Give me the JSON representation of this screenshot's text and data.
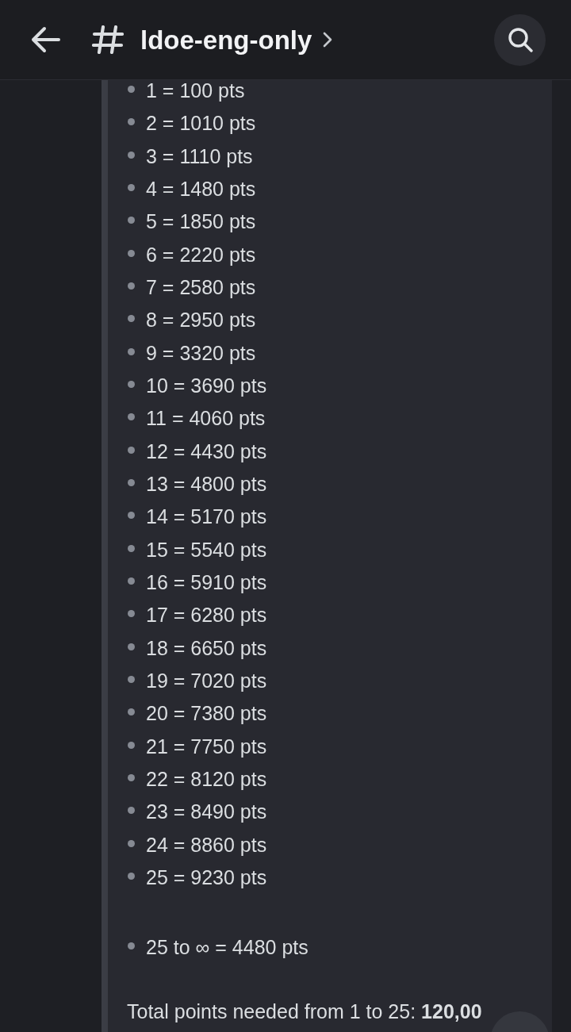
{
  "header": {
    "channel_name": "ldoe-eng-only"
  },
  "message": {
    "levels": [
      "1 = 100 pts",
      "2 = 1010 pts",
      "3 = 1110 pts",
      "4 = 1480 pts",
      "5 = 1850 pts",
      "6 = 2220 pts",
      "7 = 2580 pts",
      "8 = 2950 pts",
      "9 = 3320 pts",
      "10 = 3690 pts",
      "11 = 4060 pts",
      "12 = 4430 pts",
      "13 = 4800 pts",
      "14 = 5170 pts",
      "15 = 5540 pts",
      "16 = 5910 pts",
      "17 = 6280 pts",
      "18 = 6650 pts",
      "19 = 7020 pts",
      "20 = 7380 pts",
      "21 = 7750 pts",
      "22 = 8120 pts",
      "23 = 8490 pts",
      "24 = 8860 pts",
      "25 = 9230 pts"
    ],
    "after_levels": [
      "25 to ∞ = 4480 pts"
    ],
    "total": "Total points needed from 1 to 25: **120,00**"
  }
}
